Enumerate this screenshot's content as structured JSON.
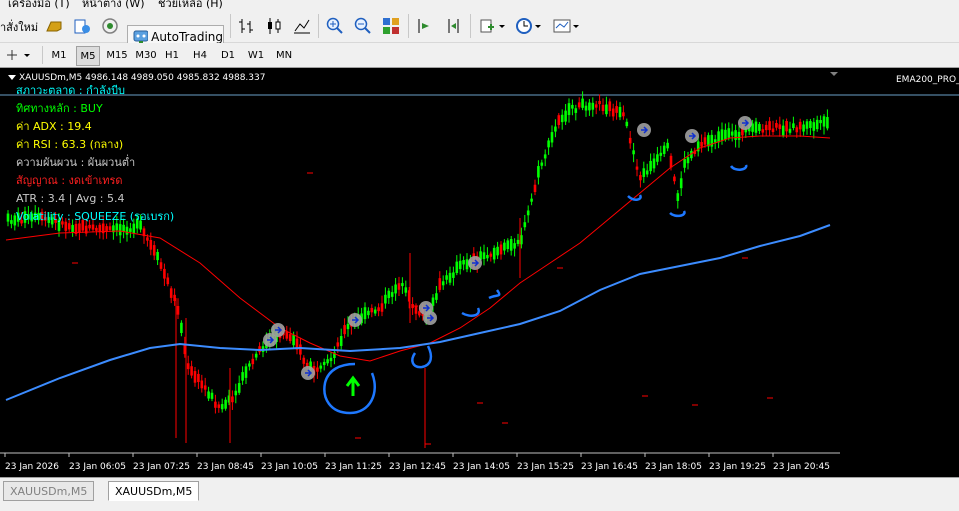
{
  "menu": {
    "items": [
      "เครื่องมือ (T)",
      "หน้าต่าง (W)",
      "ช่วยเหลือ (H)"
    ]
  },
  "toolbar": {
    "new_order_label": "าสั่งใหม่",
    "autotrading_label": "AutoTrading",
    "timeframes": [
      "M1",
      "M5",
      "M15",
      "M30",
      "H1",
      "H4",
      "D1",
      "W1",
      "MN"
    ],
    "active_timeframe": "M5"
  },
  "chart": {
    "symbol_header": "XAUUSDm,M5  4986.148 4989.050 4985.832 4988.337",
    "indicator_label": "EMA200_PRO_",
    "panel": {
      "market_state": "สภาวะตลาด : กำลังบีบ",
      "trend": "ทิศทางหลัก : BUY",
      "adx": "ค่า ADX : 19.4",
      "rsi": "ค่า RSI : 63.3 (กลาง)",
      "volatility_thai": "ความผันผวน : ผันผวนต่ำ",
      "signal": "สัญญาณ : งดเข้าเทรด",
      "atr": "ATR : 3.4 | Avg : 5.4",
      "volatility": "Volatility : SQUEEZE (รอเบรก)"
    },
    "colors": {
      "bull": "#00ff00",
      "bear": "#ff0000",
      "ema_fast": "#ff0000",
      "ema_slow": "#3c8cff",
      "annotation": "#1e78ff",
      "background": "#000000"
    },
    "time_labels": [
      "23 Jan 2026",
      "23 Jan 06:05",
      "23 Jan 07:25",
      "23 Jan 08:45",
      "23 Jan 10:05",
      "23 Jan 11:25",
      "23 Jan 12:45",
      "23 Jan 14:05",
      "23 Jan 15:25",
      "23 Jan 16:45",
      "23 Jan 18:05",
      "23 Jan 19:25",
      "23 Jan 20:45"
    ]
  },
  "tabs": [
    {
      "label": "XAUUSDm,M5",
      "active": false
    },
    {
      "label": "XAUUSDm,M5",
      "active": true
    }
  ]
}
